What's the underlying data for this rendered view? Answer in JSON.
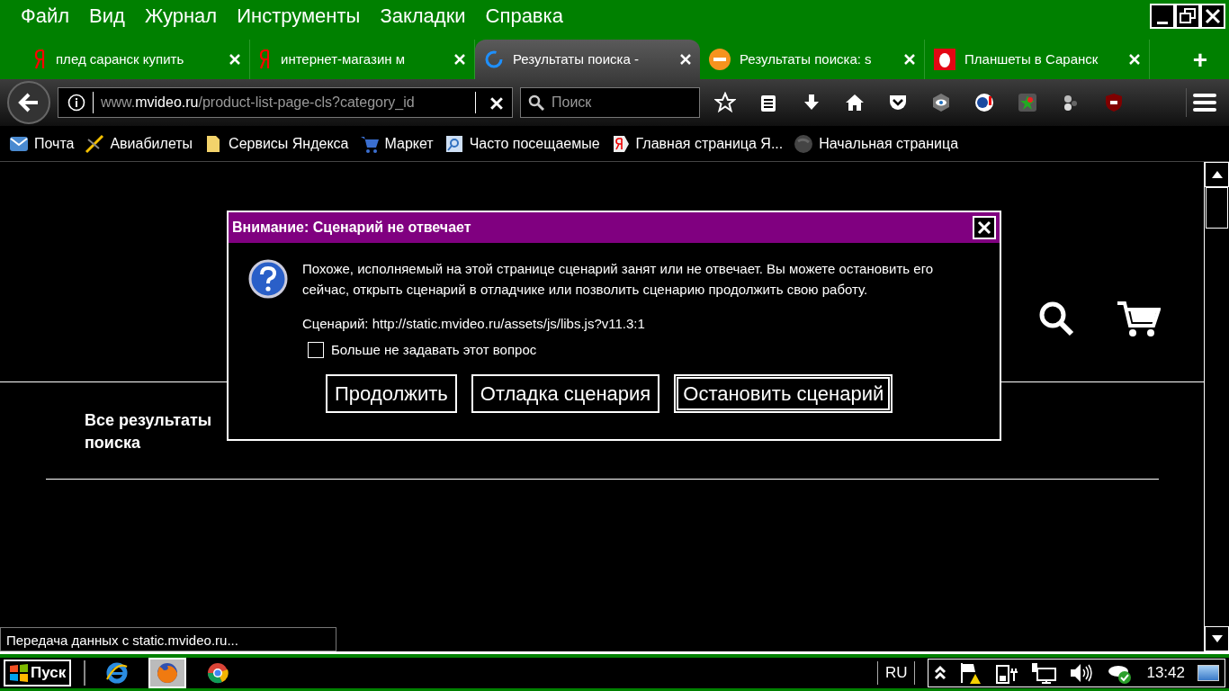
{
  "menu": [
    {
      "label": "Файл"
    },
    {
      "label": "Вид"
    },
    {
      "label": "Журнал"
    },
    {
      "label": "Инструменты"
    },
    {
      "label": "Закладки"
    },
    {
      "label": "Справка"
    }
  ],
  "tabs": [
    {
      "label": "плед саранск купить",
      "selected": false
    },
    {
      "label": "интернет-магазин м",
      "selected": false
    },
    {
      "label": "Результаты поиска -",
      "selected": true
    },
    {
      "label": "Результаты поиска: s",
      "selected": false
    },
    {
      "label": "Планшеты в Саранск",
      "selected": false
    }
  ],
  "new_tab": "+",
  "address_bar": {
    "host": "www.mvideo.ru",
    "path": "/product-list-page-cls?category_id"
  },
  "search": {
    "placeholder": "Поиск"
  },
  "bookmarks": [
    {
      "label": "Почта"
    },
    {
      "label": "Авиабилеты"
    },
    {
      "label": "Сервисы Яндекса"
    },
    {
      "label": "Маркет"
    },
    {
      "label": "Часто посещаемые"
    },
    {
      "label": "Главная страница Я..."
    },
    {
      "label": "Начальная страница"
    }
  ],
  "page": {
    "all_results": "Все результаты поиска"
  },
  "dialog": {
    "title": "Внимание: Сценарий не отвечает",
    "message": "Похоже, исполняемый на этой странице сценарий занят или не отвечает. Вы можете остановить его сейчас, открыть сценарий в отладчике или позволить сценарию продолжить свою работу.",
    "script": "Сценарий: http://static.mvideo.ru/assets/js/libs.js?v11.3:1",
    "checkbox": {
      "label": "Больше не задавать этот вопрос",
      "checked": false
    },
    "buttons": [
      {
        "label": "Продолжить",
        "default": false
      },
      {
        "label": "Отладка сценария",
        "default": false
      },
      {
        "label": "Остановить сценарий",
        "default": true
      }
    ]
  },
  "status_bar": "Передача данных с static.mvideo.ru...",
  "taskbar": {
    "start": "Пуск",
    "apps": [
      {
        "selected": false
      },
      {
        "selected": true
      },
      {
        "selected": false
      }
    ],
    "language": "RU",
    "clock": "13:42"
  }
}
